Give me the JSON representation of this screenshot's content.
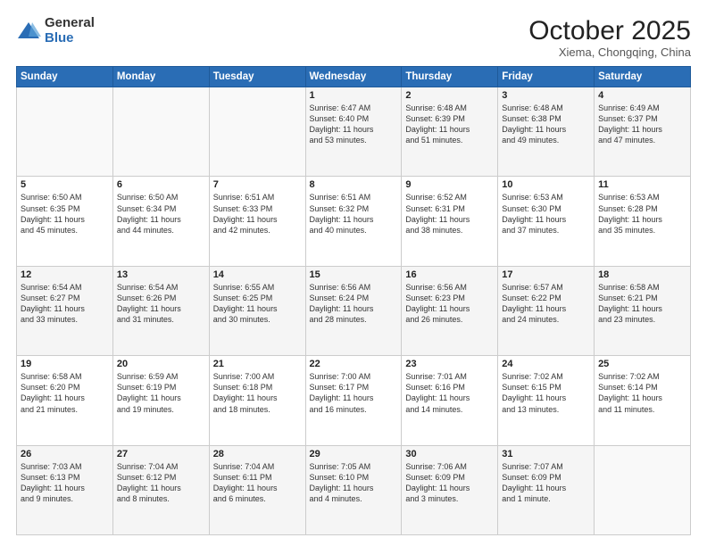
{
  "logo": {
    "general": "General",
    "blue": "Blue"
  },
  "header": {
    "month": "October 2025",
    "location": "Xiema, Chongqing, China"
  },
  "weekdays": [
    "Sunday",
    "Monday",
    "Tuesday",
    "Wednesday",
    "Thursday",
    "Friday",
    "Saturday"
  ],
  "weeks": [
    [
      {
        "day": "",
        "info": ""
      },
      {
        "day": "",
        "info": ""
      },
      {
        "day": "",
        "info": ""
      },
      {
        "day": "1",
        "info": "Sunrise: 6:47 AM\nSunset: 6:40 PM\nDaylight: 11 hours\nand 53 minutes."
      },
      {
        "day": "2",
        "info": "Sunrise: 6:48 AM\nSunset: 6:39 PM\nDaylight: 11 hours\nand 51 minutes."
      },
      {
        "day": "3",
        "info": "Sunrise: 6:48 AM\nSunset: 6:38 PM\nDaylight: 11 hours\nand 49 minutes."
      },
      {
        "day": "4",
        "info": "Sunrise: 6:49 AM\nSunset: 6:37 PM\nDaylight: 11 hours\nand 47 minutes."
      }
    ],
    [
      {
        "day": "5",
        "info": "Sunrise: 6:50 AM\nSunset: 6:35 PM\nDaylight: 11 hours\nand 45 minutes."
      },
      {
        "day": "6",
        "info": "Sunrise: 6:50 AM\nSunset: 6:34 PM\nDaylight: 11 hours\nand 44 minutes."
      },
      {
        "day": "7",
        "info": "Sunrise: 6:51 AM\nSunset: 6:33 PM\nDaylight: 11 hours\nand 42 minutes."
      },
      {
        "day": "8",
        "info": "Sunrise: 6:51 AM\nSunset: 6:32 PM\nDaylight: 11 hours\nand 40 minutes."
      },
      {
        "day": "9",
        "info": "Sunrise: 6:52 AM\nSunset: 6:31 PM\nDaylight: 11 hours\nand 38 minutes."
      },
      {
        "day": "10",
        "info": "Sunrise: 6:53 AM\nSunset: 6:30 PM\nDaylight: 11 hours\nand 37 minutes."
      },
      {
        "day": "11",
        "info": "Sunrise: 6:53 AM\nSunset: 6:28 PM\nDaylight: 11 hours\nand 35 minutes."
      }
    ],
    [
      {
        "day": "12",
        "info": "Sunrise: 6:54 AM\nSunset: 6:27 PM\nDaylight: 11 hours\nand 33 minutes."
      },
      {
        "day": "13",
        "info": "Sunrise: 6:54 AM\nSunset: 6:26 PM\nDaylight: 11 hours\nand 31 minutes."
      },
      {
        "day": "14",
        "info": "Sunrise: 6:55 AM\nSunset: 6:25 PM\nDaylight: 11 hours\nand 30 minutes."
      },
      {
        "day": "15",
        "info": "Sunrise: 6:56 AM\nSunset: 6:24 PM\nDaylight: 11 hours\nand 28 minutes."
      },
      {
        "day": "16",
        "info": "Sunrise: 6:56 AM\nSunset: 6:23 PM\nDaylight: 11 hours\nand 26 minutes."
      },
      {
        "day": "17",
        "info": "Sunrise: 6:57 AM\nSunset: 6:22 PM\nDaylight: 11 hours\nand 24 minutes."
      },
      {
        "day": "18",
        "info": "Sunrise: 6:58 AM\nSunset: 6:21 PM\nDaylight: 11 hours\nand 23 minutes."
      }
    ],
    [
      {
        "day": "19",
        "info": "Sunrise: 6:58 AM\nSunset: 6:20 PM\nDaylight: 11 hours\nand 21 minutes."
      },
      {
        "day": "20",
        "info": "Sunrise: 6:59 AM\nSunset: 6:19 PM\nDaylight: 11 hours\nand 19 minutes."
      },
      {
        "day": "21",
        "info": "Sunrise: 7:00 AM\nSunset: 6:18 PM\nDaylight: 11 hours\nand 18 minutes."
      },
      {
        "day": "22",
        "info": "Sunrise: 7:00 AM\nSunset: 6:17 PM\nDaylight: 11 hours\nand 16 minutes."
      },
      {
        "day": "23",
        "info": "Sunrise: 7:01 AM\nSunset: 6:16 PM\nDaylight: 11 hours\nand 14 minutes."
      },
      {
        "day": "24",
        "info": "Sunrise: 7:02 AM\nSunset: 6:15 PM\nDaylight: 11 hours\nand 13 minutes."
      },
      {
        "day": "25",
        "info": "Sunrise: 7:02 AM\nSunset: 6:14 PM\nDaylight: 11 hours\nand 11 minutes."
      }
    ],
    [
      {
        "day": "26",
        "info": "Sunrise: 7:03 AM\nSunset: 6:13 PM\nDaylight: 11 hours\nand 9 minutes."
      },
      {
        "day": "27",
        "info": "Sunrise: 7:04 AM\nSunset: 6:12 PM\nDaylight: 11 hours\nand 8 minutes."
      },
      {
        "day": "28",
        "info": "Sunrise: 7:04 AM\nSunset: 6:11 PM\nDaylight: 11 hours\nand 6 minutes."
      },
      {
        "day": "29",
        "info": "Sunrise: 7:05 AM\nSunset: 6:10 PM\nDaylight: 11 hours\nand 4 minutes."
      },
      {
        "day": "30",
        "info": "Sunrise: 7:06 AM\nSunset: 6:09 PM\nDaylight: 11 hours\nand 3 minutes."
      },
      {
        "day": "31",
        "info": "Sunrise: 7:07 AM\nSunset: 6:09 PM\nDaylight: 11 hours\nand 1 minute."
      },
      {
        "day": "",
        "info": ""
      }
    ]
  ]
}
